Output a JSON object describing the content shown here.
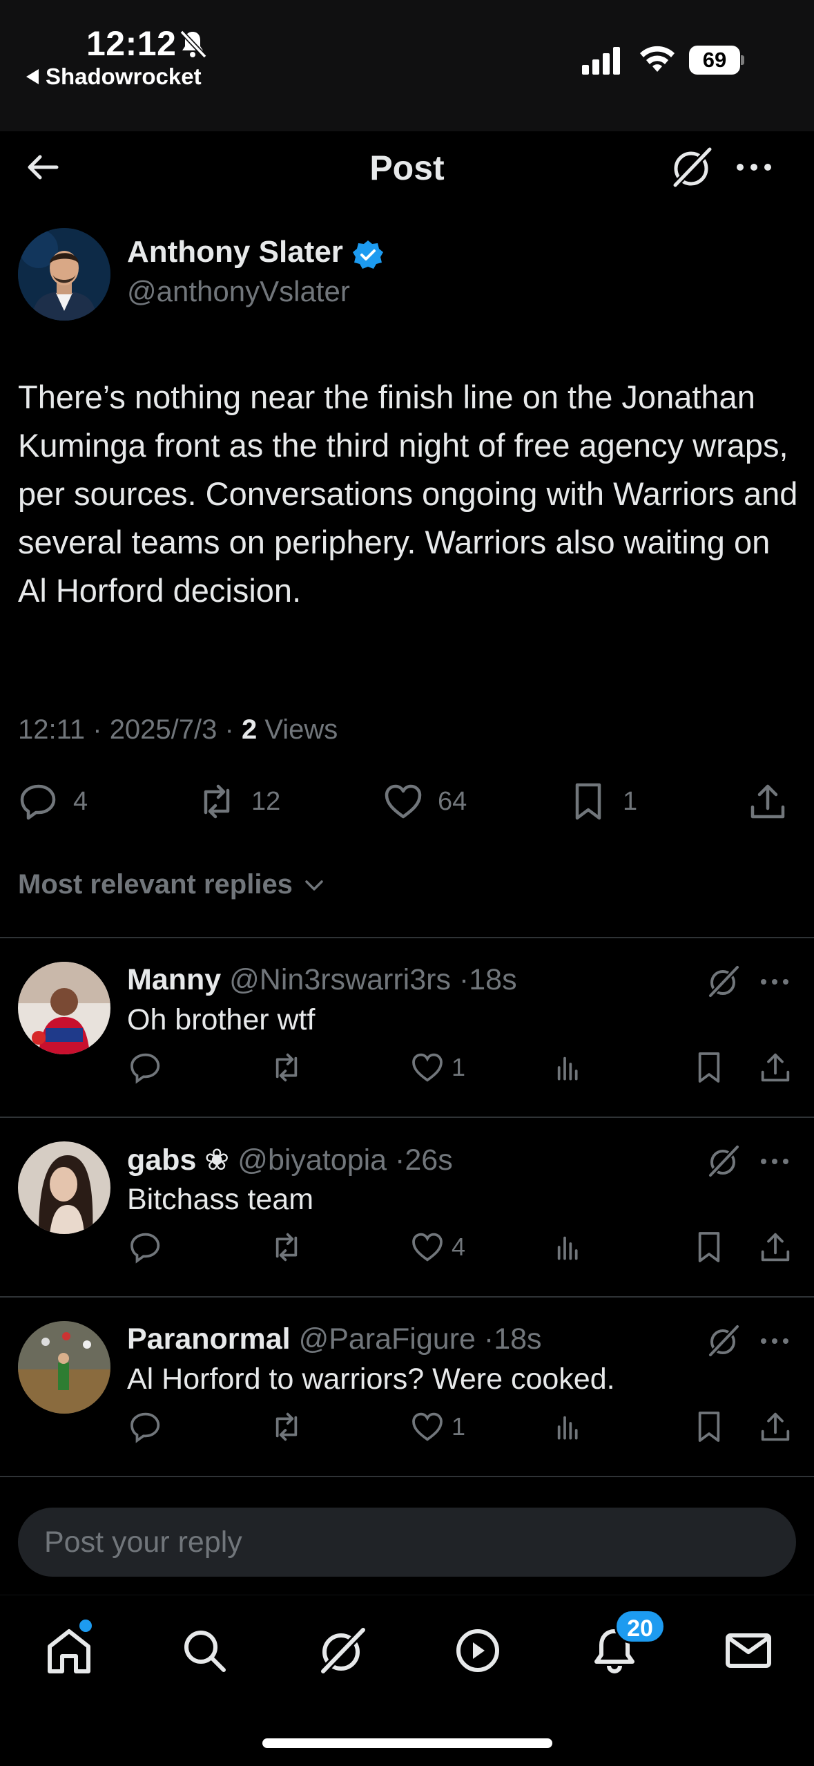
{
  "status_bar": {
    "time": "12:12",
    "back_app": "Shadowrocket",
    "battery": "69"
  },
  "header": {
    "title": "Post"
  },
  "post": {
    "author_name": "Anthony Slater",
    "author_handle": "@anthonyVslater",
    "text": "There’s nothing near the finish line on the Jonathan Kuminga front as the third night of free agency wraps, per sources. Conversations ongoing with Warriors and several teams on periphery. Warriors also waiting on Al Horford decision.",
    "time": "12:11",
    "date": "2025/7/3",
    "views_count": "2",
    "views_label": "Views",
    "replies": "4",
    "reposts": "12",
    "likes": "64",
    "bookmarks": "1"
  },
  "replies_filter": {
    "label": "Most relevant replies"
  },
  "replies": [
    {
      "name": "Manny",
      "handle": "@Nin3rswarri3rs",
      "age": "18s",
      "text": "Oh brother wtf",
      "likes": "1"
    },
    {
      "name": "gabs ❀",
      "handle": "@biyatopia",
      "age": "26s",
      "text": "Bitchass team",
      "likes": "4"
    },
    {
      "name": "Paranormal",
      "handle": "@ParaFigure",
      "age": "18s",
      "text": "Al Horford to warriors? Were cooked.",
      "likes": "1"
    }
  ],
  "composer": {
    "placeholder": "Post your reply"
  },
  "tabbar": {
    "notifications_badge": "20"
  },
  "colors": {
    "background": "#000000",
    "text": "#e7e9ea",
    "muted": "#71767b",
    "accent": "#1d9bf0",
    "divider": "#2f3336"
  }
}
